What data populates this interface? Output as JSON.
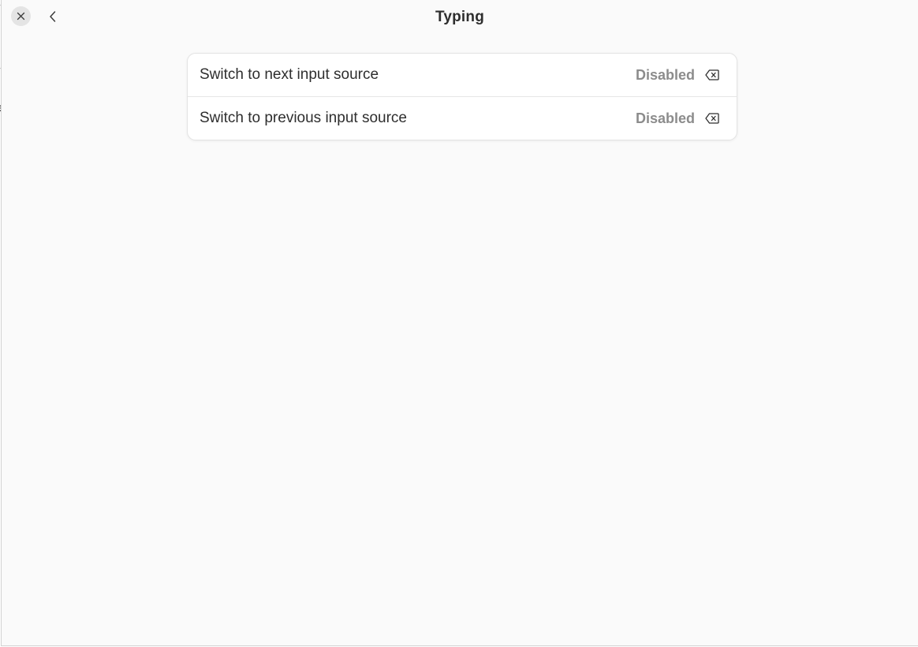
{
  "header": {
    "title": "Typing",
    "close_icon": "close-icon",
    "back_icon": "chevron-left-icon"
  },
  "shortcuts": [
    {
      "label": "Switch to next input source",
      "value": "Disabled",
      "clear_icon": "backspace-clear-icon"
    },
    {
      "label": "Switch to previous input source",
      "value": "Disabled",
      "clear_icon": "backspace-clear-icon"
    }
  ],
  "colors": {
    "background": "#fafafa",
    "card": "#ffffff",
    "text": "#2e2e2e",
    "muted_text": "#8c8c8c",
    "close_button_bg": "#e4e4e4"
  }
}
